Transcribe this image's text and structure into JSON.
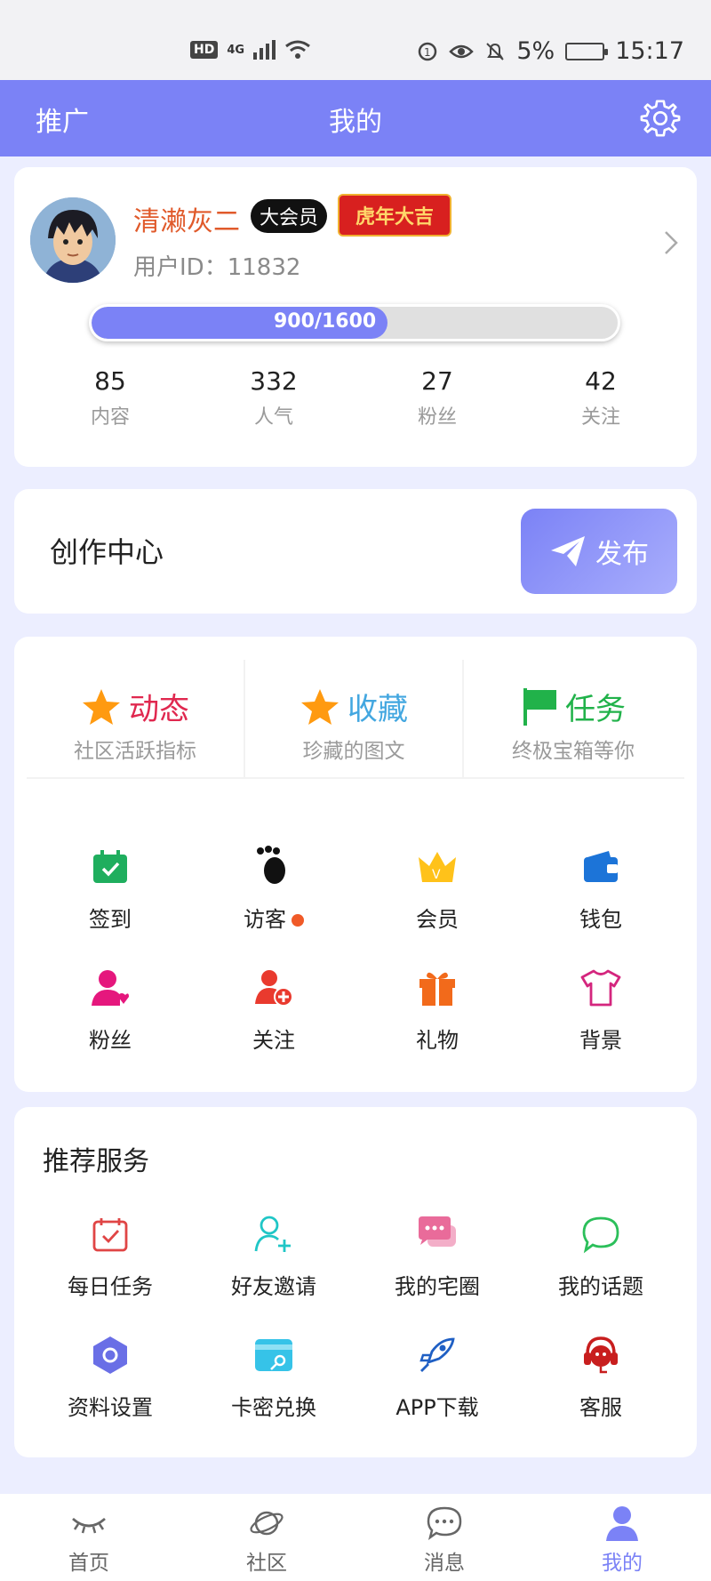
{
  "status_bar": {
    "hd": "HD",
    "network": "4G",
    "battery": "5%",
    "time": "15:17"
  },
  "header": {
    "promo": "推广",
    "title": "我的",
    "settings_icon": "gear-icon"
  },
  "profile": {
    "username": "清濑灰二",
    "vip_badge": "大会员",
    "festival_badge": "虎年大吉",
    "user_id": "用户ID：11832",
    "progress_text": "900/1600",
    "progress_value": 0.5625,
    "stats": [
      {
        "value": "85",
        "label": "内容"
      },
      {
        "value": "332",
        "label": "人气"
      },
      {
        "value": "27",
        "label": "粉丝"
      },
      {
        "value": "42",
        "label": "关注"
      }
    ]
  },
  "creation": {
    "title": "创作中心",
    "publish_label": "发布"
  },
  "features": [
    {
      "title": "动态",
      "subtitle": "社区活跃指标",
      "icon": "star-icon",
      "color": "#e0284f"
    },
    {
      "title": "收藏",
      "subtitle": "珍藏的图文",
      "icon": "star-icon",
      "color": "#43a7e0"
    },
    {
      "title": "任务",
      "subtitle": "终极宝箱等你",
      "icon": "flag-icon",
      "color": "#21b24a"
    }
  ],
  "quick_grid": [
    {
      "label": "签到",
      "icon": "calendar-check-icon"
    },
    {
      "label": "访客",
      "icon": "footprint-icon",
      "dot": true
    },
    {
      "label": "会员",
      "icon": "crown-icon"
    },
    {
      "label": "钱包",
      "icon": "wallet-icon"
    },
    {
      "label": "粉丝",
      "icon": "fans-icon"
    },
    {
      "label": "关注",
      "icon": "add-user-icon"
    },
    {
      "label": "礼物",
      "icon": "gift-icon"
    },
    {
      "label": "背景",
      "icon": "tshirt-icon"
    }
  ],
  "services": {
    "title": "推荐服务",
    "items": [
      {
        "label": "每日任务",
        "icon": "daily-task-icon"
      },
      {
        "label": "好友邀请",
        "icon": "invite-friend-icon"
      },
      {
        "label": "我的宅圈",
        "icon": "chat-bubbles-icon"
      },
      {
        "label": "我的话题",
        "icon": "topic-bubble-icon"
      },
      {
        "label": "资料设置",
        "icon": "hexagon-settings-icon"
      },
      {
        "label": "卡密兑换",
        "icon": "card-redeem-icon"
      },
      {
        "label": "APP下载",
        "icon": "rocket-icon"
      },
      {
        "label": "客服",
        "icon": "customer-service-icon"
      }
    ]
  },
  "bottom_nav": [
    {
      "label": "首页",
      "icon": "eye-closed-icon"
    },
    {
      "label": "社区",
      "icon": "planet-icon"
    },
    {
      "label": "消息",
      "icon": "message-icon"
    },
    {
      "label": "我的",
      "icon": "user-icon",
      "active": true
    }
  ],
  "colors": {
    "accent": "#7b82f6",
    "background": "#eceeff"
  }
}
